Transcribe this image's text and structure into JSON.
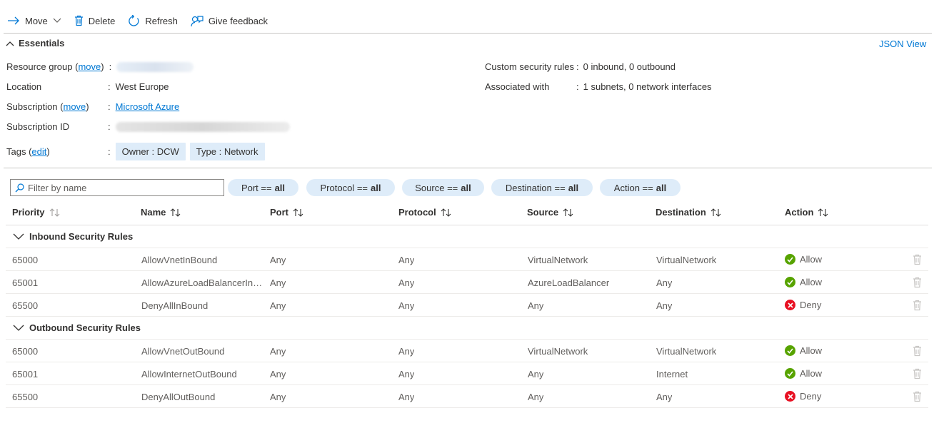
{
  "toolbar": {
    "move": "Move",
    "delete": "Delete",
    "refresh": "Refresh",
    "feedback": "Give feedback"
  },
  "essentials": {
    "title": "Essentials",
    "json_view": "JSON View",
    "resource_group_label": "Resource group",
    "move_link": "move",
    "location_label": "Location",
    "location_value": "West Europe",
    "subscription_label": "Subscription",
    "subscription_value": "Microsoft Azure",
    "subscription_id_label": "Subscription ID",
    "tags_label": "Tags",
    "tags_edit": "edit",
    "tags": [
      "Owner : DCW",
      "Type : Network"
    ],
    "custom_rules_label": "Custom security rules",
    "custom_rules_value": "0 inbound, 0 outbound",
    "associated_label": "Associated with",
    "associated_value": "1 subnets, 0 network interfaces"
  },
  "filter": {
    "placeholder": "Filter by name",
    "pills": [
      {
        "label": "Port ==",
        "value": "all"
      },
      {
        "label": "Protocol ==",
        "value": "all"
      },
      {
        "label": "Source ==",
        "value": "all"
      },
      {
        "label": "Destination ==",
        "value": "all"
      },
      {
        "label": "Action ==",
        "value": "all"
      }
    ]
  },
  "table": {
    "columns": [
      "Priority",
      "Name",
      "Port",
      "Protocol",
      "Source",
      "Destination",
      "Action"
    ],
    "groups": [
      {
        "title": "Inbound Security Rules",
        "rows": [
          {
            "priority": "65000",
            "name": "AllowVnetInBound",
            "port": "Any",
            "protocol": "Any",
            "source": "VirtualNetwork",
            "destination": "VirtualNetwork",
            "action": "Allow"
          },
          {
            "priority": "65001",
            "name": "AllowAzureLoadBalancerInBound",
            "port": "Any",
            "protocol": "Any",
            "source": "AzureLoadBalancer",
            "destination": "Any",
            "action": "Allow"
          },
          {
            "priority": "65500",
            "name": "DenyAllInBound",
            "port": "Any",
            "protocol": "Any",
            "source": "Any",
            "destination": "Any",
            "action": "Deny"
          }
        ]
      },
      {
        "title": "Outbound Security Rules",
        "rows": [
          {
            "priority": "65000",
            "name": "AllowVnetOutBound",
            "port": "Any",
            "protocol": "Any",
            "source": "VirtualNetwork",
            "destination": "VirtualNetwork",
            "action": "Allow"
          },
          {
            "priority": "65001",
            "name": "AllowInternetOutBound",
            "port": "Any",
            "protocol": "Any",
            "source": "Any",
            "destination": "Internet",
            "action": "Allow"
          },
          {
            "priority": "65500",
            "name": "DenyAllOutBound",
            "port": "Any",
            "protocol": "Any",
            "source": "Any",
            "destination": "Any",
            "action": "Deny"
          }
        ]
      }
    ]
  },
  "colors": {
    "accent": "#0078d4",
    "allow": "#57a300",
    "deny": "#e81123",
    "pill_bg": "#deecf9"
  }
}
